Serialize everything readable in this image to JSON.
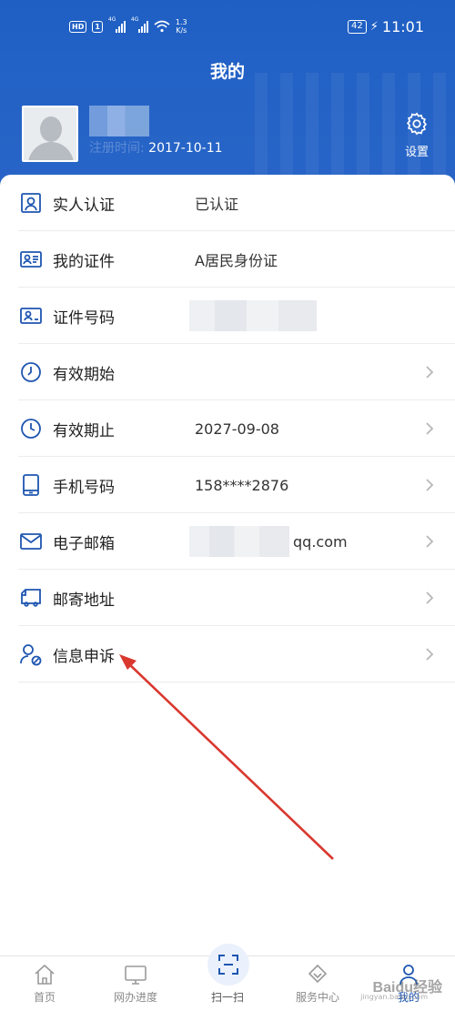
{
  "status_bar": {
    "hd": "HD",
    "sim": "1",
    "net1": "4G",
    "net2": "4G",
    "speed_value": "1.3",
    "speed_unit": "K/s",
    "battery": "42",
    "time": "11:01"
  },
  "header": {
    "title": "我的",
    "register_label": "注册时间:",
    "register_date": "2017-10-11",
    "settings_label": "设置"
  },
  "rows": [
    {
      "label": "实人认证",
      "value": "已认证",
      "icon": "person-id-icon",
      "chevron": false
    },
    {
      "label": "我的证件",
      "value": "A居民身份证",
      "icon": "id-card-icon",
      "chevron": false
    },
    {
      "label": "证件号码",
      "value": "",
      "icon": "id-photo-icon",
      "chevron": false
    },
    {
      "label": "有效期始",
      "value": "",
      "icon": "clock-icon",
      "chevron": true
    },
    {
      "label": "有效期止",
      "value": "2027-09-08",
      "icon": "clock-icon",
      "chevron": true
    },
    {
      "label": "手机号码",
      "value": "158****2876",
      "icon": "phone-icon",
      "chevron": true
    },
    {
      "label": "电子邮箱",
      "value": "qq.com",
      "icon": "mail-icon",
      "chevron": true
    },
    {
      "label": "邮寄地址",
      "value": "",
      "icon": "truck-icon",
      "chevron": true
    },
    {
      "label": "信息申诉",
      "value": "",
      "icon": "user-edit-icon",
      "chevron": true
    }
  ],
  "bottom_nav": {
    "home": "首页",
    "progress": "网办进度",
    "scan": "扫一扫",
    "service": "服务中心",
    "mine": "我的"
  },
  "watermark": {
    "brand": "Baidu经验",
    "sub": "jingyan.baidu.com"
  },
  "colors": {
    "header_blue": "#1f5fc4",
    "icon_blue": "#1e56b1",
    "annotation_arrow": "#d9382f"
  }
}
